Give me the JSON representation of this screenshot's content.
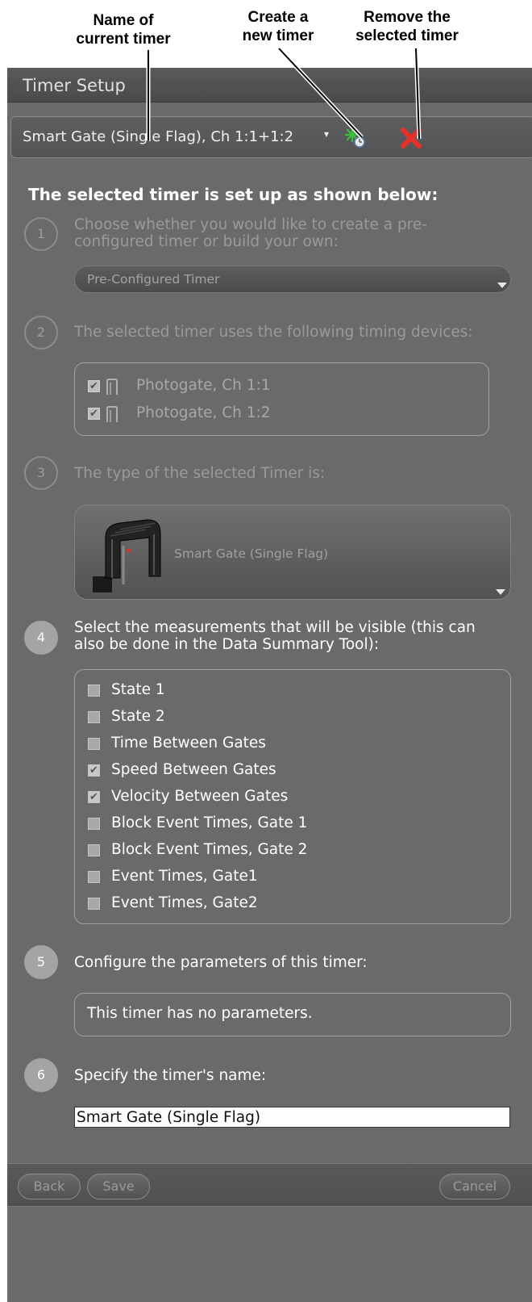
{
  "annotations": {
    "name_line1": "Name of",
    "name_line2": "current timer",
    "create_line1": "Create a",
    "create_line2": "new timer",
    "remove_line1": "Remove the",
    "remove_line2": "selected timer"
  },
  "window": {
    "title": "Timer Setup"
  },
  "timer_selector": {
    "current": "Smart Gate (Single Flag), Ch 1:1+1:2"
  },
  "heading": "The selected timer is set up as shown below:",
  "steps": [
    {
      "number": "1",
      "line1": "Choose whether you would like to create a pre-",
      "line2": "configured timer or build your own:",
      "active": false
    },
    {
      "number": "2",
      "line1": "The selected timer uses the following timing devices:",
      "active": false
    },
    {
      "number": "3",
      "line1": "The type of the selected Timer is:",
      "active": false
    },
    {
      "number": "4",
      "line1": "Select the measurements that will be visible (this can",
      "line2": "also be done in the Data Summary Tool):",
      "active": true
    },
    {
      "number": "5",
      "line1": "Configure the parameters of this timer:",
      "active": true
    },
    {
      "number": "6",
      "line1": "Specify the timer's name:",
      "active": true
    }
  ],
  "timer_mode": {
    "selected": "Pre-Configured Timer"
  },
  "devices": [
    {
      "label": "Photogate, Ch 1:1",
      "checked": true
    },
    {
      "label": "Photogate, Ch 1:2",
      "checked": true
    }
  ],
  "timer_type": {
    "selected": "Smart Gate (Single Flag)"
  },
  "measurements": [
    {
      "label": "State 1",
      "checked": false
    },
    {
      "label": "State 2",
      "checked": false
    },
    {
      "label": "Time Between Gates",
      "checked": false
    },
    {
      "label": "Speed Between Gates",
      "checked": true
    },
    {
      "label": "Velocity Between Gates",
      "checked": true
    },
    {
      "label": "Block Event Times, Gate 1",
      "checked": false
    },
    {
      "label": "Block Event Times, Gate 2",
      "checked": false
    },
    {
      "label": "Event Times, Gate1",
      "checked": false
    },
    {
      "label": "Event Times, Gate2",
      "checked": false
    }
  ],
  "parameters": {
    "message": "This timer has no parameters."
  },
  "timer_name": {
    "value": "Smart Gate (Single Flag)"
  },
  "footer": {
    "back": "Back",
    "save": "Save",
    "cancel": "Cancel"
  },
  "checkmark_glyph": "✔",
  "colors": {
    "panel": "#6a6a6c",
    "remove_icon": "#e8302a",
    "new_timer_icon": "#3fbf3f"
  }
}
